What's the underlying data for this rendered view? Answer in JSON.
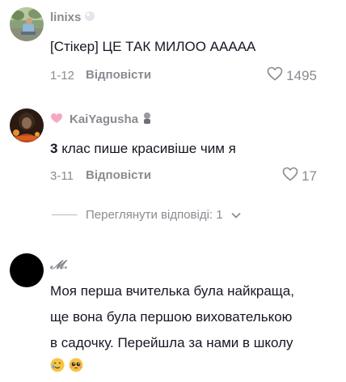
{
  "comments": [
    {
      "username": "linixs",
      "text": "[Стікер] ЦЕ ТАК МИЛОО ААААА",
      "date": "1-12",
      "reply_label": "Відповісти",
      "likes": "1495"
    },
    {
      "username": "KaiYagusha",
      "text_bold": "3",
      "text": " клас пише красивіше чим я",
      "date": "3-11",
      "reply_label": "Відповісти",
      "likes": "17",
      "view_replies": "Переглянути відповіді: 1"
    },
    {
      "username": "𝓜.",
      "text_lines": [
        "Моя перша вчителька була найкраща,",
        "ще вона була першою вихователькою",
        "в садочку. Перейшла за нами в школу"
      ],
      "emojis": [
        "smiling-face-with-tear-emoji",
        "pleading-face-emoji"
      ]
    }
  ],
  "colors": {
    "text": "#161823",
    "secondary": "#8a8b91",
    "heart_deco": "#f7a8c0"
  }
}
